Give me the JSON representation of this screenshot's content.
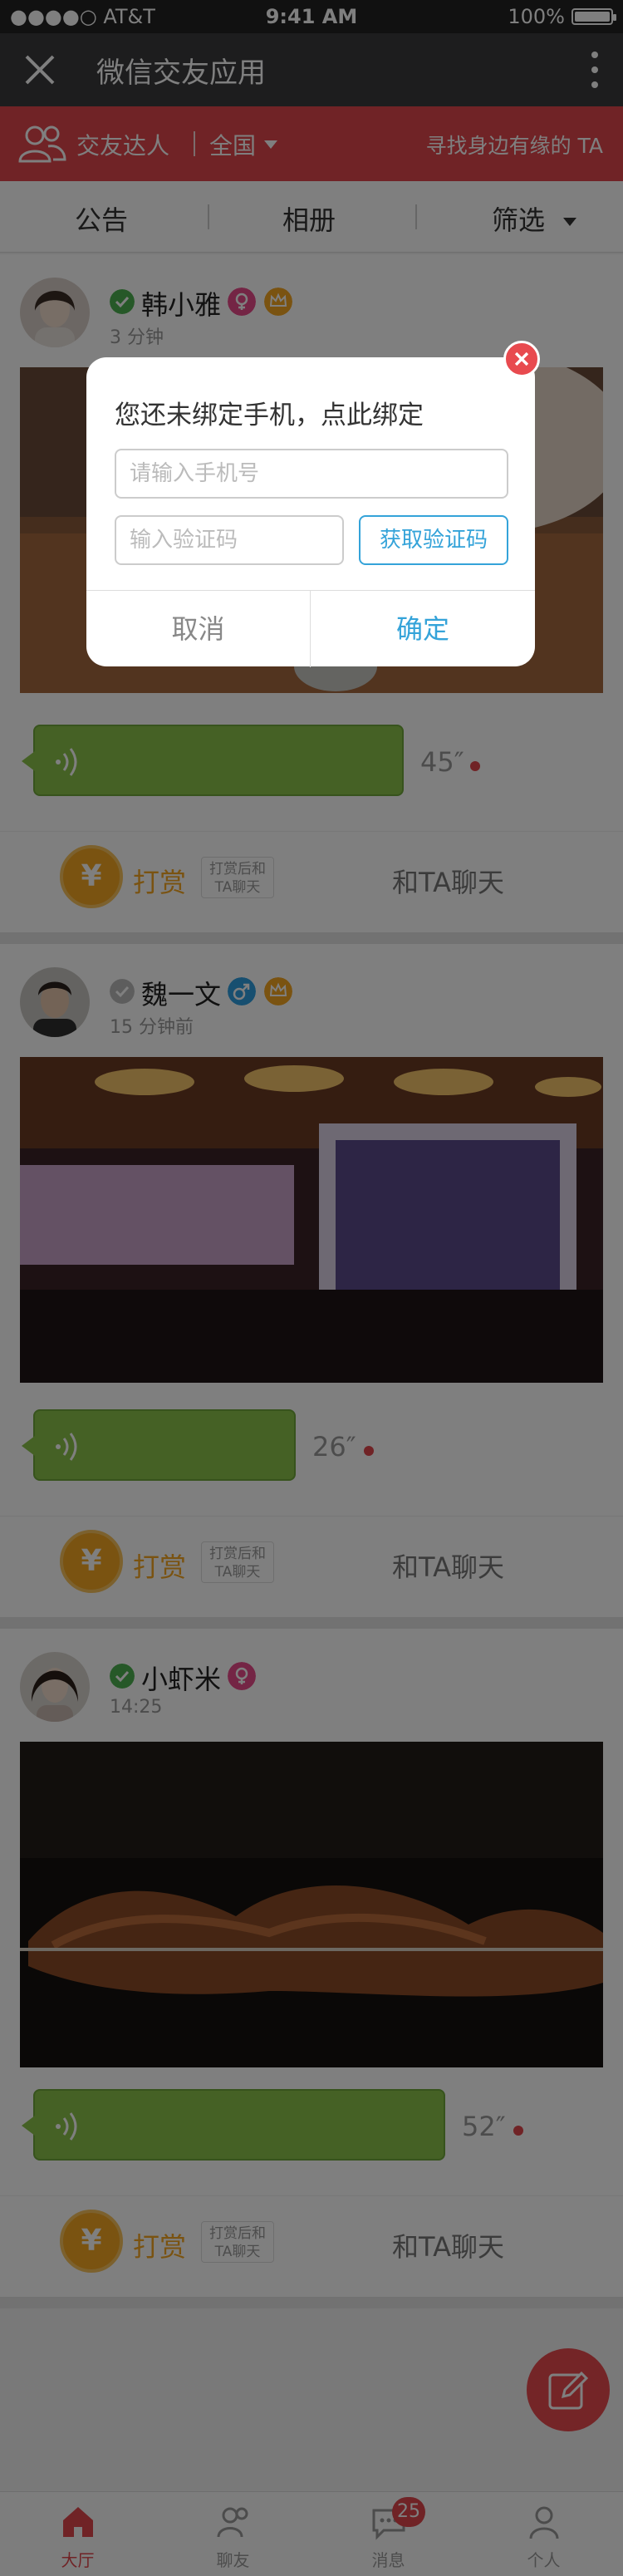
{
  "status_bar": {
    "carrier": "●●●●○ AT&T",
    "time": "9:41 AM",
    "battery": "100%"
  },
  "nav": {
    "title": "微信交友应用"
  },
  "filter_bar": {
    "label": "交友达人",
    "region": "全国",
    "hint": "寻找身边有缘的 TA"
  },
  "tabs": [
    "公告",
    "相册",
    "筛选"
  ],
  "posts": [
    {
      "name": "韩小雅",
      "time": "3 分钟",
      "verified": true,
      "gender": "female",
      "duration": "45″",
      "reward_label": "打赏",
      "reward_tip": "打赏后和TA聊天",
      "chat_label": "和TA聊天"
    },
    {
      "name": "魏一文",
      "time": "15 分钟前",
      "verified": false,
      "gender": "male",
      "duration": "26″",
      "reward_label": "打赏",
      "reward_tip": "打赏后和TA聊天",
      "chat_label": "和TA聊天"
    },
    {
      "name": "小虾米",
      "time": "14:25",
      "verified": true,
      "gender": "female",
      "duration": "52″",
      "reward_label": "打赏",
      "reward_tip": "打赏后和TA聊天",
      "chat_label": "和TA聊天"
    }
  ],
  "modal": {
    "title": "您还未绑定手机，点此绑定",
    "phone_placeholder": "请输入手机号",
    "code_placeholder": "输入验证码",
    "get_code": "获取验证码",
    "cancel": "取消",
    "confirm": "确定"
  },
  "bottom_tabs": [
    {
      "label": "大厅",
      "icon": "hall-icon",
      "active": true
    },
    {
      "label": "聊友",
      "icon": "friends-icon"
    },
    {
      "label": "消息",
      "icon": "message-icon",
      "badge": "25"
    },
    {
      "label": "个人",
      "icon": "profile-icon"
    }
  ],
  "colors": {
    "brand_red": "#e0474c",
    "accent_blue": "#34a3d9",
    "voice_green": "#8bc34a",
    "reward_orange": "#f5a623"
  }
}
